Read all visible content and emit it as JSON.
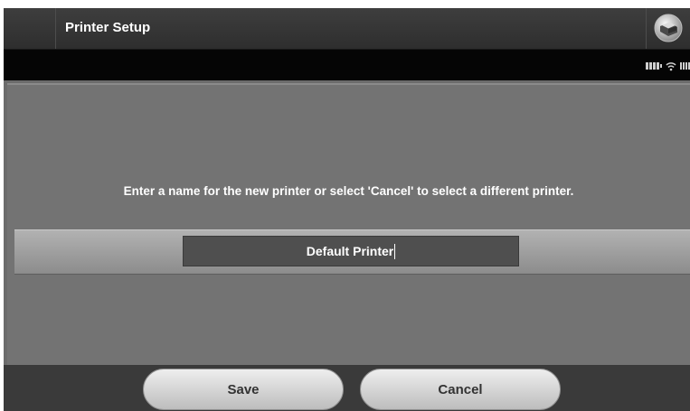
{
  "header": {
    "title": "Printer Setup",
    "app_icon": "printer-app-icon"
  },
  "status": {
    "icons": [
      "battery-icon",
      "wifi-icon",
      "signal-icon"
    ]
  },
  "main": {
    "prompt": "Enter a name for the new printer or select 'Cancel' to select a different printer.",
    "printer_name_value": "Default Printer"
  },
  "footer": {
    "save_label": "Save",
    "cancel_label": "Cancel"
  }
}
